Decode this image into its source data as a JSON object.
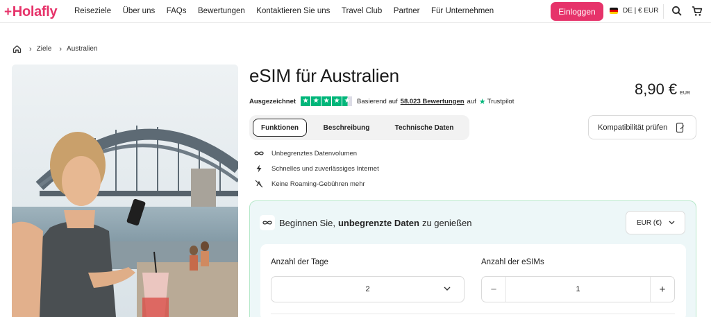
{
  "header": {
    "logo": "Holafly",
    "nav": [
      "Reiseziele",
      "Über uns",
      "FAQs",
      "Bewertungen",
      "Kontaktieren Sie uns",
      "Travel Club",
      "Partner",
      "Für Unternehmen"
    ],
    "login_label": "Einloggen",
    "language": "DE | € EUR",
    "icons": [
      "search-icon",
      "cart-icon"
    ],
    "brand_color": "#e6336a"
  },
  "breadcrumb": {
    "items": [
      "Ziele",
      "Australien"
    ]
  },
  "product": {
    "title": "eSIM für Australien",
    "rating_word": "Ausgezeichnet",
    "stars": 4.5,
    "review_prefix": "Basierend auf",
    "review_count": "58.023 Bewertungen",
    "review_suffix": "auf",
    "review_source": "Trustpilot",
    "price": "8,90 €",
    "currency_code": "EUR"
  },
  "tabs": [
    "Funktionen",
    "Beschreibung",
    "Technische Daten"
  ],
  "active_tab": "Funktionen",
  "compatibility_label": "Kompatibilität prüfen",
  "features": [
    {
      "icon": "infinity-icon",
      "label": "Unbegrenztes Datenvolumen"
    },
    {
      "icon": "lightning-icon",
      "label": "Schnelles und zuverlässiges Internet"
    },
    {
      "icon": "no-roaming-icon",
      "label": "Keine Roaming-Gebühren mehr"
    }
  ],
  "plan": {
    "heading_start": "Beginnen Sie,",
    "heading_bold": "unbegrenzte Daten",
    "heading_end": "zu genießen",
    "currency_select": "EUR (€)",
    "days_label": "Anzahl der Tage",
    "days_value": "2",
    "esims_label": "Anzahl der eSIMs",
    "esims_value": "1",
    "minus": "−",
    "plus": "+"
  }
}
